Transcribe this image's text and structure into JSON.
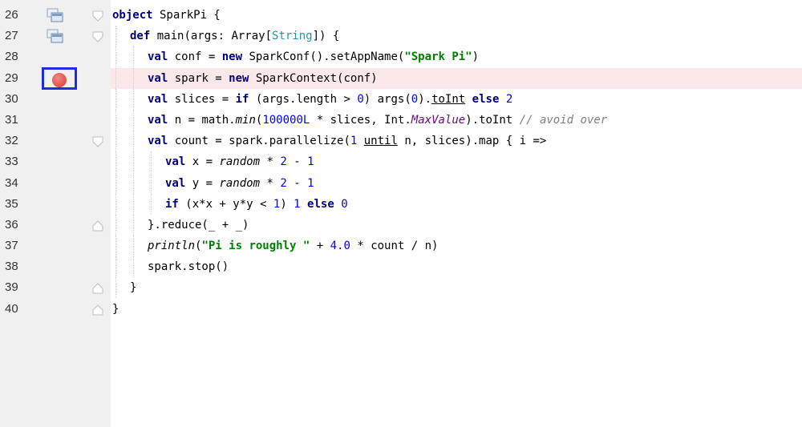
{
  "editor": {
    "lines": [
      {
        "n": "26",
        "tokens": {
          "t1": "object",
          "t2": " SparkPi {"
        }
      },
      {
        "n": "27",
        "tokens": {
          "t1": "def",
          "t2": " main(args: Array[",
          "t3": "String",
          "t4": "]) {"
        }
      },
      {
        "n": "28",
        "tokens": {
          "t1": "val",
          "t2": " conf = ",
          "t3": "new",
          "t4": " SparkConf().setAppName(",
          "t5": "\"Spark Pi\"",
          "t6": ")"
        }
      },
      {
        "n": "29",
        "tokens": {
          "t1": "val",
          "t2": " spark = ",
          "t3": "new",
          "t4": " SparkContext(conf)"
        }
      },
      {
        "n": "30",
        "tokens": {
          "t1": "val",
          "t2": " slices = ",
          "t3": "if",
          "t4": " (args.length > ",
          "t5": "0",
          "t6": ") args(",
          "t7": "0",
          "t8": ").",
          "t9": "toInt",
          "t10": " ",
          "t11": "else",
          "t12": " ",
          "t13": "2"
        }
      },
      {
        "n": "31",
        "tokens": {
          "t1": "val",
          "t2": " n = math.",
          "t3": "min",
          "t4": "(",
          "t5": "100000L",
          "t6": " * slices, Int.",
          "t7": "MaxValue",
          "t8": ").toInt ",
          "t9": "// avoid over"
        }
      },
      {
        "n": "32",
        "tokens": {
          "t1": "val",
          "t2": " count = spark.parallelize(",
          "t3": "1",
          "t4": " ",
          "t5": "until",
          "t6": " n, slices).map { i =>"
        }
      },
      {
        "n": "33",
        "tokens": {
          "t1": "val",
          "t2": " x = ",
          "t3": "random",
          "t4": " * ",
          "t5": "2",
          "t6": " - ",
          "t7": "1"
        }
      },
      {
        "n": "34",
        "tokens": {
          "t1": "val",
          "t2": " y = ",
          "t3": "random",
          "t4": " * ",
          "t5": "2",
          "t6": " - ",
          "t7": "1"
        }
      },
      {
        "n": "35",
        "tokens": {
          "t1": "if",
          "t2": " (x*x + y*y < ",
          "t3": "1",
          "t4": ") ",
          "t5": "1",
          "t6": " ",
          "t7": "else",
          "t8": " ",
          "t9": "0"
        }
      },
      {
        "n": "36",
        "tokens": {
          "t1": "}.reduce(_ + _)"
        }
      },
      {
        "n": "37",
        "tokens": {
          "t1": "println",
          "t2": "(",
          "t3": "\"Pi is roughly \"",
          "t4": " + ",
          "t5": "4.0",
          "t6": " * count / n)"
        }
      },
      {
        "n": "38",
        "tokens": {
          "t1": "spark.stop()"
        }
      },
      {
        "n": "39",
        "tokens": {
          "t1": "}"
        }
      },
      {
        "n": "40",
        "tokens": {
          "t1": "}"
        }
      }
    ]
  },
  "colors": {
    "keyword": "#000080",
    "string": "#008000",
    "number": "#0000ff",
    "type": "#20999d",
    "field": "#660e7a",
    "comment": "#808080",
    "breakpoint": "#de4f47",
    "breakpoint_highlight": "#1f2ddf",
    "breakpoint_line_bg": "#fbe9e9",
    "gutter_bg": "#f0f0f0"
  },
  "icons": {
    "line26": "run-gutter-icon",
    "line27": "run-gutter-icon",
    "line29": "breakpoint-icon",
    "fold": "fold-marker-icon"
  }
}
